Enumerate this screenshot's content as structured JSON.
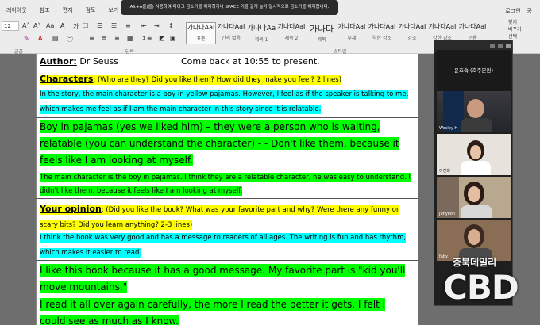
{
  "ribbon": {
    "tabs": [
      "레이아웃",
      "참조",
      "편지",
      "검토",
      "보기",
      "디자인"
    ],
    "right_links": [
      "로그인",
      "공"
    ],
    "font_size": "12",
    "group_labels": {
      "clipboard": "글꼴",
      "paragraph": "단락",
      "styles": "스타일"
    },
    "styles": [
      {
        "sample": "가나다AaI",
        "label": "표준",
        "selected": true
      },
      {
        "sample": "가나다AaI",
        "label": "간격 없음"
      },
      {
        "sample": "가나다Aa",
        "label": "제목 1"
      },
      {
        "sample": "가나다AaI",
        "label": "제목 2"
      },
      {
        "sample": "가나다",
        "label": "제목"
      },
      {
        "sample": "가나다AaI",
        "label": "부제"
      },
      {
        "sample": "가나다AaI",
        "label": "약한 강조"
      },
      {
        "sample": "가나다AaI",
        "label": "강조"
      },
      {
        "sample": "가나다AaI",
        "label": "강한 강조"
      },
      {
        "sample": "가나다AaI",
        "label": "인용"
      }
    ],
    "right_tools": [
      "찾기",
      "바꾸기",
      "선택"
    ]
  },
  "toast": "Alt+A를(를) 사용하여 마이크 음소거를 해제하거나 SPACE 키를 길게 눌러 일시적으로 음소거를 해제합니다.",
  "document": {
    "author_label": "Author:",
    "author_value": "Dr Seuss",
    "come_back": "Come back at 10:55 to present.",
    "characters_label": "Characters",
    "characters_prompt": ": (Who are they? Did you like them? How did they make you feel? 2 lines)",
    "characters_p1": "In the story, the main character is a boy in yellow pajamas. However, I feel as if the speaker is talking to me, which makes me feel as if I am the main character in this story since it is relatable.",
    "characters_p2": "Boy in pajamas (yes we liked him) – they were a person who is waiting, relatable (you can understand the character) - - Don't like them, because it feels like I am looking at myself.",
    "characters_p3": "The main character is the boy in pajamas. I think they are a relatable character, he was easy to understand. I didn't like them, because it feels like I am looking at myself.",
    "opinion_label": "Your opinion",
    "opinion_prompt": ": (Did you like the book? What was your favorite part and why? Were there any funny or scary bits? Did you learn anything? 2-3 lines)",
    "opinion_p1": "I think the book was very good and has a message to readers of all ages. The writing is fun and has rhythm, which makes it easier to read.",
    "opinion_p2": "I like this book because it has a good message. My favorite part is \"kid you'll move mountains.\"",
    "opinion_p3": "I read it all over again carefully, the more I read the better it gets. I felt I could see as much as I know."
  },
  "zoom": {
    "participants": [
      "윤효숙 (호주분원)",
      "Wesley H",
      "이진희",
      "Juhyeon",
      "faby"
    ]
  },
  "watermark": {
    "sub": "충북데일리",
    "main": "CBD"
  }
}
